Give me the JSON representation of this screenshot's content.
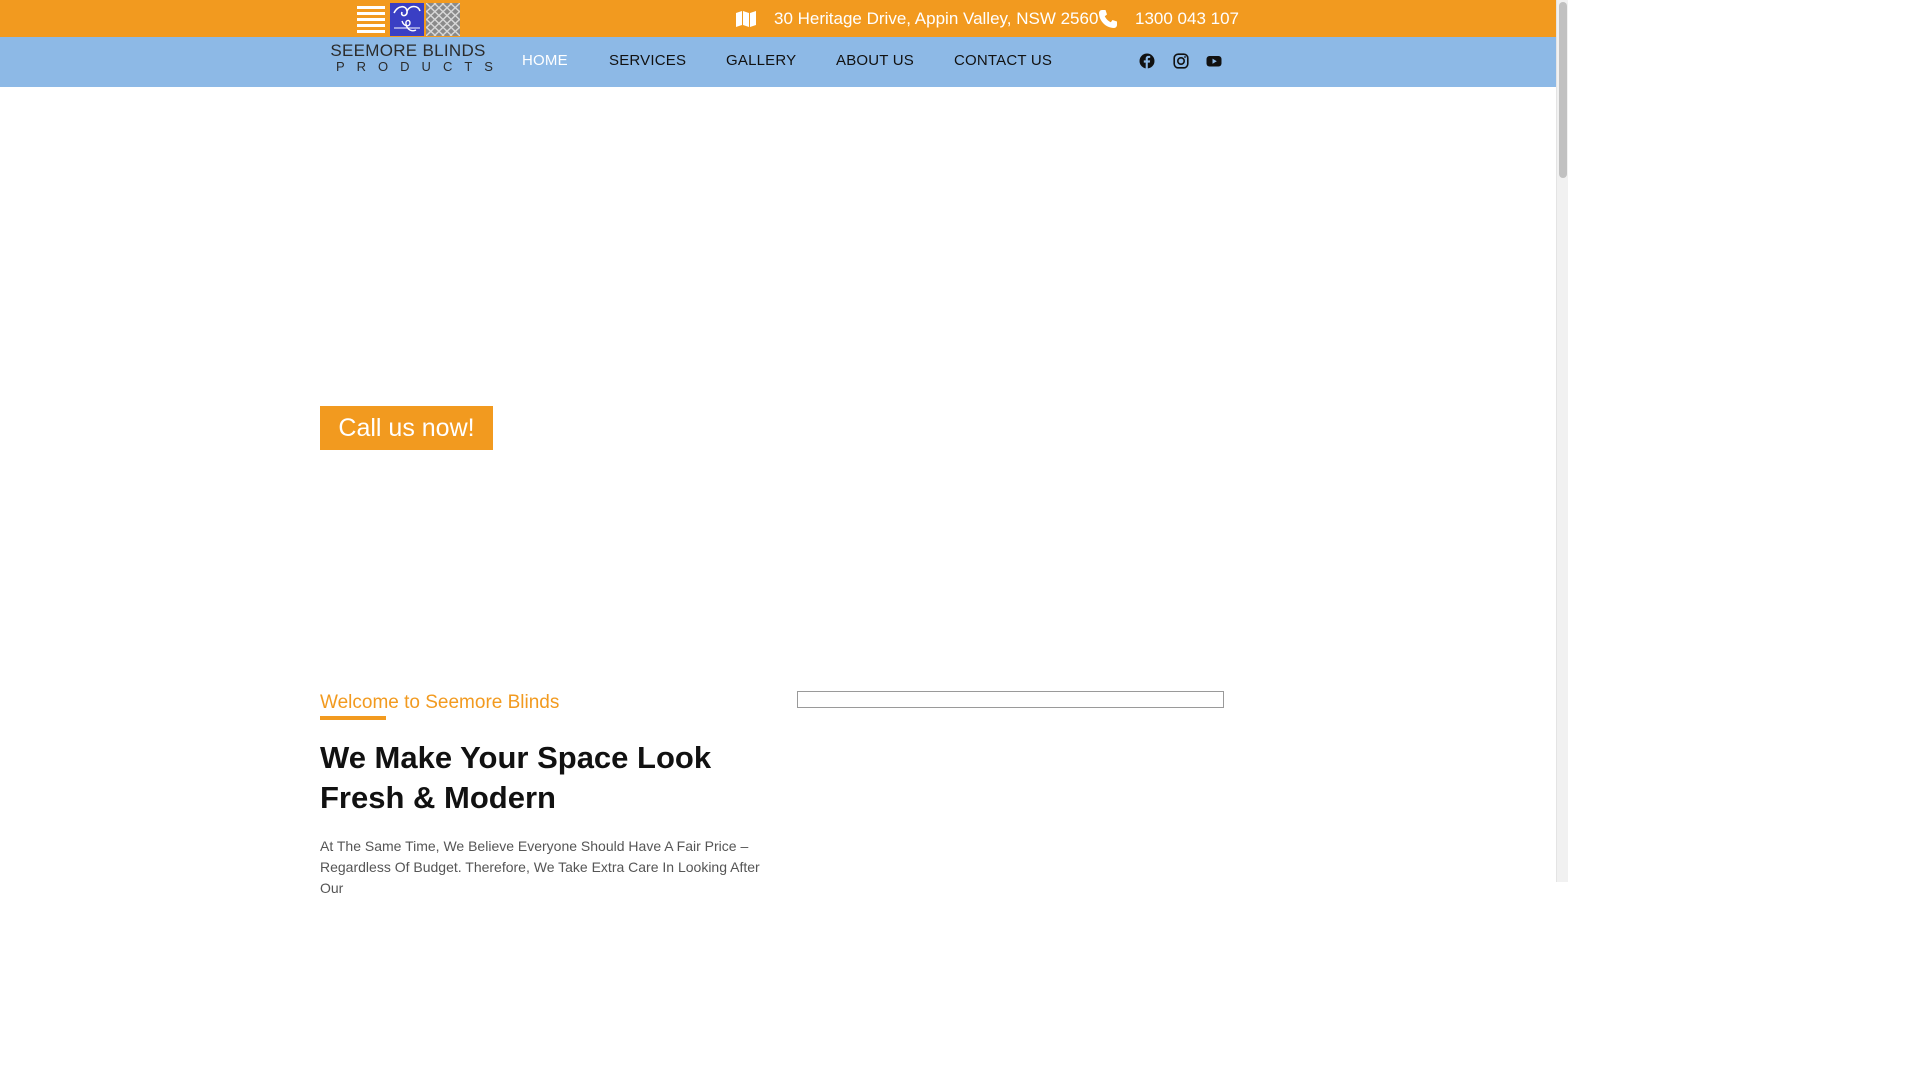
{
  "topbar": {
    "address": "30 Heritage Drive, Appin Valley, NSW 2560",
    "phone": "1300 043 107",
    "address_icon": "map-icon",
    "phone_icon": "phone-icon",
    "background": "#f29a1f"
  },
  "logo": {
    "brand": "SEEMORE BLINDS",
    "sub": "PRODUCTS"
  },
  "nav": {
    "items": [
      {
        "label": "HOME",
        "active": true
      },
      {
        "label": "SERVICES",
        "active": false
      },
      {
        "label": "GALLERY",
        "active": false
      },
      {
        "label": "ABOUT US",
        "active": false
      },
      {
        "label": "CONTACT US",
        "active": false
      }
    ],
    "background": "#8db9e6"
  },
  "social": [
    "facebook-icon",
    "instagram-icon",
    "youtube-icon"
  ],
  "hero": {
    "cta_label": "Call us now!"
  },
  "welcome": {
    "eyebrow": "Welcome to Seemore Blinds",
    "headline": "We Make Your Space Look Fresh & Modern",
    "body": "At The Same Time, We Believe Everyone Should Have A Fair Price – Regardless Of Budget. Therefore, We Take Extra Care In Looking After Our"
  },
  "colors": {
    "accent": "#f29a1f",
    "nav": "#8db9e6"
  }
}
